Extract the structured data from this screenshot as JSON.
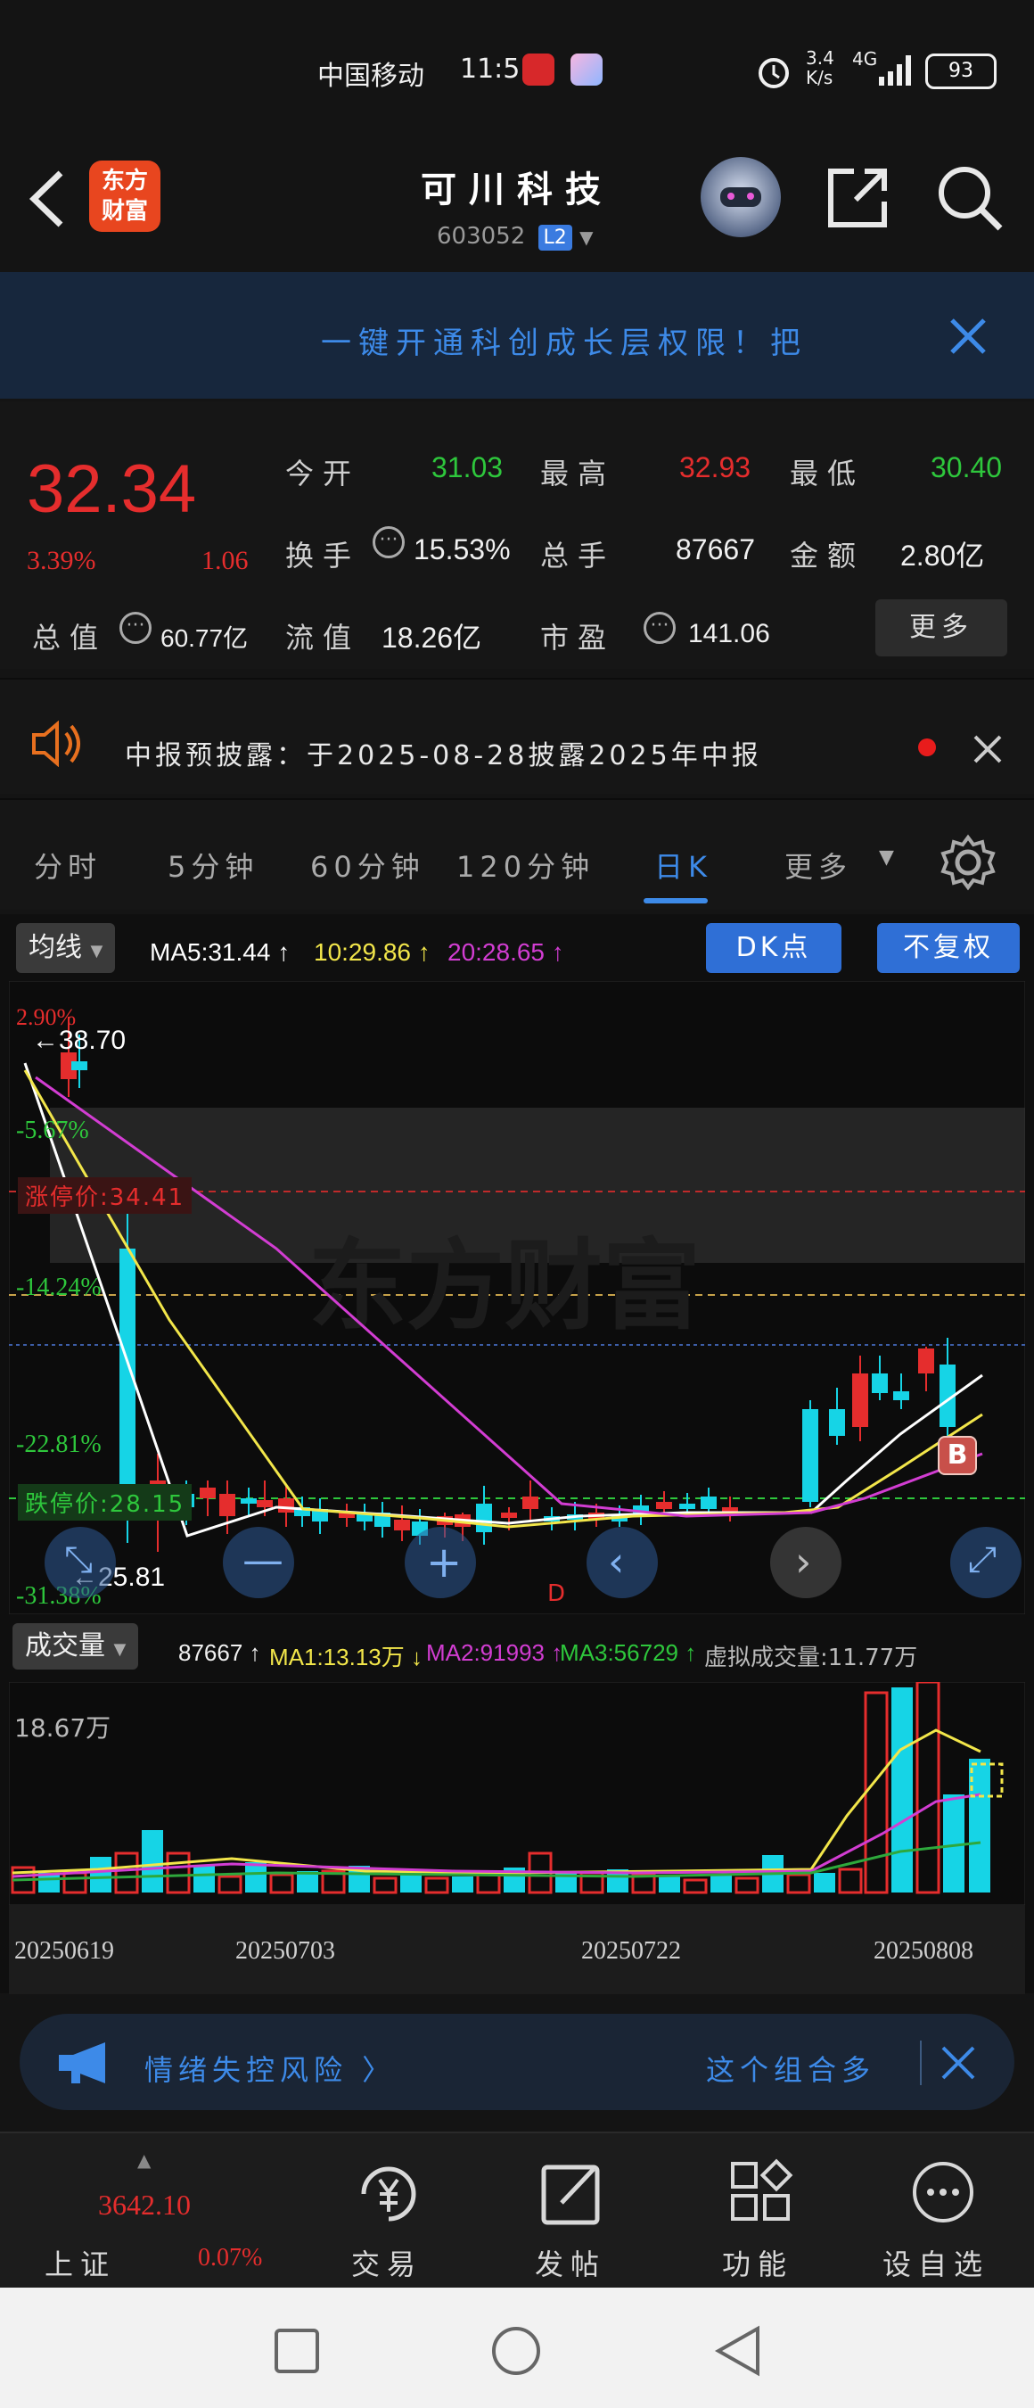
{
  "status_bar": {
    "carrier": "中国移动",
    "time": "11:51",
    "speed": "3.4 K/s",
    "network": "4G",
    "battery": "93"
  },
  "header": {
    "logo_text_1": "东方",
    "logo_text_2": "财富",
    "stock_name": "可川科技",
    "stock_code": "603052",
    "level_badge": "L2"
  },
  "banner": {
    "text": "一键开通科创成长层权限！把"
  },
  "quote": {
    "price": "32.34",
    "change_pct": "3.39%",
    "change_amt": "1.06",
    "open_label": "今开",
    "open_value": "31.03",
    "high_label": "最高",
    "high_value": "32.93",
    "low_label": "最低",
    "low_value": "30.40",
    "turnover_label": "换手",
    "turnover_value": "15.53%",
    "volume_label": "总手",
    "volume_value": "87667",
    "amount_label": "金额",
    "amount_value": "2.80亿",
    "mktcap_label": "总值",
    "mktcap_value": "60.77亿",
    "float_label": "流值",
    "float_value": "18.26亿",
    "pe_label": "市盈",
    "pe_value": "141.06",
    "more_label": "更多"
  },
  "notice": {
    "text": "中报预披露：于2025-08-28披露2025年中报"
  },
  "period_tabs": [
    {
      "label": "分时"
    },
    {
      "label": "5分钟"
    },
    {
      "label": "60分钟"
    },
    {
      "label": "120分钟"
    },
    {
      "label": "日K"
    },
    {
      "label": "更多"
    }
  ],
  "chart_toolbar": {
    "indicator": "均线",
    "ma5": "MA5:31.44 ↑",
    "ma10": "10:29.86 ↑",
    "ma20": "20:28.65 ↑",
    "dk_button": "DK点",
    "fq_button": "不复权"
  },
  "kline_labels": {
    "pct_top": "2.90%",
    "pct_2": "-5.67%",
    "pct_3": "-14.24%",
    "pct_4": "-22.81%",
    "pct_5": "-31.38%",
    "high_marker": "38.70",
    "low_marker": "25.81",
    "limit_up": "涨停价:34.41",
    "limit_down": "跌停价:28.15",
    "b_marker": "B",
    "d_marker": "D"
  },
  "volume_toolbar": {
    "indicator": "成交量",
    "vol": "87667 ↑",
    "ma1": "MA1:13.13万 ↓",
    "ma2": "MA2:91993 ↑",
    "ma3": "MA3:56729 ↑",
    "virtual": "虚拟成交量:11.77万",
    "axis_max": "18.67万"
  },
  "dates": [
    "20250619",
    "20250703",
    "20250722",
    "20250808"
  ],
  "promo": {
    "left": "情绪失控风险 〉",
    "right": "这个组合多"
  },
  "bottom_nav": {
    "index_value": "3642.10",
    "index_pct": "0.07%",
    "index_label": "上证",
    "trade": "交易",
    "post": "发帖",
    "func": "功能",
    "watch": "设自选"
  },
  "colors": {
    "up": "#e52d2d",
    "down": "#16d4e6",
    "ma5": "#ffffff",
    "ma10": "#f2e64a",
    "ma20": "#d23dd2",
    "accent": "#3d8ae8"
  },
  "chart_data": {
    "type": "candlestick",
    "x": [
      "20250619",
      "20250620",
      "20250623",
      "20250624",
      "20250625",
      "20250626",
      "20250627",
      "20250630",
      "20250701",
      "20250702",
      "20250703",
      "20250704",
      "20250707",
      "20250708",
      "20250709",
      "20250710",
      "20250711",
      "20250714",
      "20250715",
      "20250716",
      "20250717",
      "20250718",
      "20250721",
      "20250722",
      "20250723",
      "20250724",
      "20250725",
      "20250728",
      "20250729",
      "20250730",
      "20250731",
      "20250801",
      "20250804",
      "20250805",
      "20250806",
      "20250807",
      "20250808",
      "20250811"
    ],
    "price_axis": {
      "top_pct": 2.9,
      "bottom_pct": -31.38
    },
    "ma": {
      "ma5": 31.44,
      "ma10": 29.86,
      "ma20": 28.65
    },
    "high": 38.7,
    "low": 25.81,
    "last": 32.34
  }
}
